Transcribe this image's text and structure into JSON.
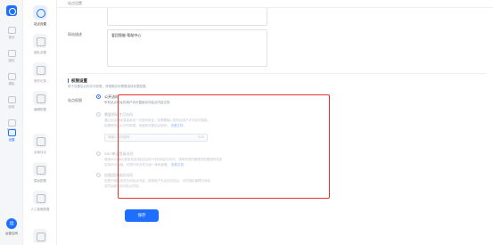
{
  "rail1": {
    "items": [
      {
        "label": "首页"
      },
      {
        "label": "团队"
      },
      {
        "label": "模板"
      },
      {
        "label": "回收"
      },
      {
        "label": "知识库"
      },
      {
        "label": "设置"
      }
    ],
    "avatar_text": "运",
    "footer": "运营空间"
  },
  "rail2": {
    "items": [
      {
        "label": "站点设置"
      },
      {
        "label": "团队设置"
      },
      {
        "label": "操作记录"
      },
      {
        "label": "编辑配置"
      },
      {
        "label": "全局评论"
      },
      {
        "label": "模板配置"
      },
      {
        "label": "人工客服配置"
      },
      {
        "label": ""
      }
    ]
  },
  "topbar": {
    "title": "站点设置"
  },
  "site_desc": {
    "label": "网站描述",
    "value": "爱回智能·帮助中心"
  },
  "permission": {
    "section_title": "权限设置",
    "section_sub": "用于设置站点的访问权限，请根据实际需要选择权限配置。",
    "label": "站点权限",
    "options": [
      {
        "title": "公开访问",
        "desc": "所有站点地址的用户均可直接访问站点内容文档",
        "checked": true
      },
      {
        "title": "需要密码才可访问",
        "desc_line1": "通过站点地址直接参加一次密码验证，若需要输入密码后用户才可访问链接。",
        "desc_line2": "如需修改为公开的权限，请重新设置站点密码。",
        "link": "查看文档",
        "input_placeholder": "请输入访问密码",
        "input_count": "0/10",
        "checked": false
      },
      {
        "title": "SSO单点登录访问",
        "desc_line1": "使用SSO(单点登录系统)验证后用户可在网站中访问，请联系您的管理员配置相关信息",
        "desc_line2": "支持SSO对接，可提升安全性与统一身份管理。",
        "link": "查看文档",
        "checked": false
      },
      {
        "title": "仅限团队成员访问",
        "desc_line1": "仅限于团队成员访问站点内容，其他用户无法访问站点，可在团队管理中添加",
        "desc_line2": "成员后即可访问站点内容。",
        "checked": false
      }
    ]
  },
  "save_button": "保存",
  "colors": {
    "accent": "#1e6fff",
    "highlight": "#e8342f"
  }
}
